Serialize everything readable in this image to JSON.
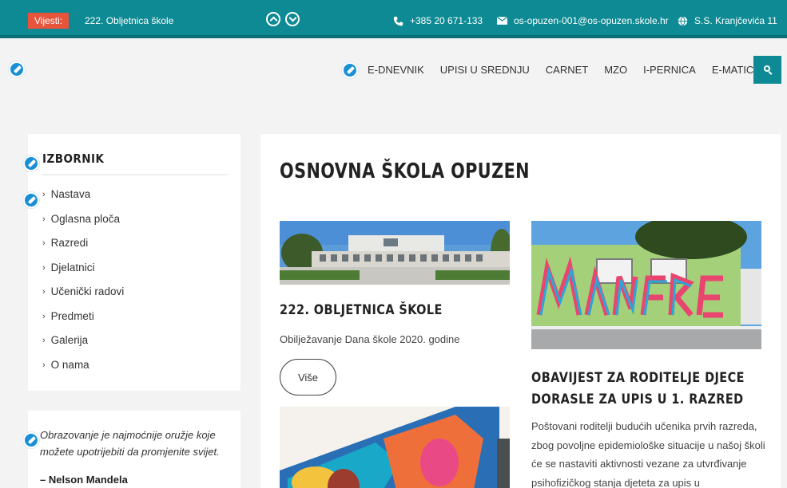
{
  "topbar": {
    "news_label": "Vijesti:",
    "news_text": "222. Obljetnica škole",
    "phone": "+385 20 671-133",
    "email": "os-opuzen-001@os-opuzen.skole.hr",
    "address": "S.S. Kranjčevića 11"
  },
  "nav": {
    "items": [
      "E-DNEVNIK",
      "UPISI U SREDNJU",
      "CARNET",
      "MZO",
      "I-PERNICA",
      "E-MATICA"
    ]
  },
  "sidebar": {
    "title": "IZBORNIK",
    "items": [
      "Nastava",
      "Oglasna ploča",
      "Razredi",
      "Djelatnici",
      "Učenički radovi",
      "Predmeti",
      "Galerija",
      "O nama"
    ]
  },
  "quote": {
    "text": "Obrazovanje je najmoćnije oružje koje možete upotrijebiti da promjenite svijet.",
    "author": "– Nelson Mandela"
  },
  "main": {
    "title": "OSNOVNA ŠKOLA OPUZEN",
    "article1": {
      "title": "222. OBLJETNICA ŠKOLE",
      "subtitle": "Obilježavanje Dana škole 2020. godine",
      "more_label": "Više"
    },
    "article2": {
      "title": "OBAVIJEST ZA RODITELJE DJECE DORASLE ZA UPIS U 1. RAZRED",
      "text": "Poštovani roditelji budućih učenika prvih razreda, zbog povoljne epidemiološke situacije u našoj školi će se nastaviti aktivnosti vezane za utvrđivanje psihofizičkog stanja djeteta za upis u"
    }
  },
  "colors": {
    "brand": "#0d8a93",
    "news_label": "#e8533b",
    "edit_badge": "#1a8fd6"
  }
}
